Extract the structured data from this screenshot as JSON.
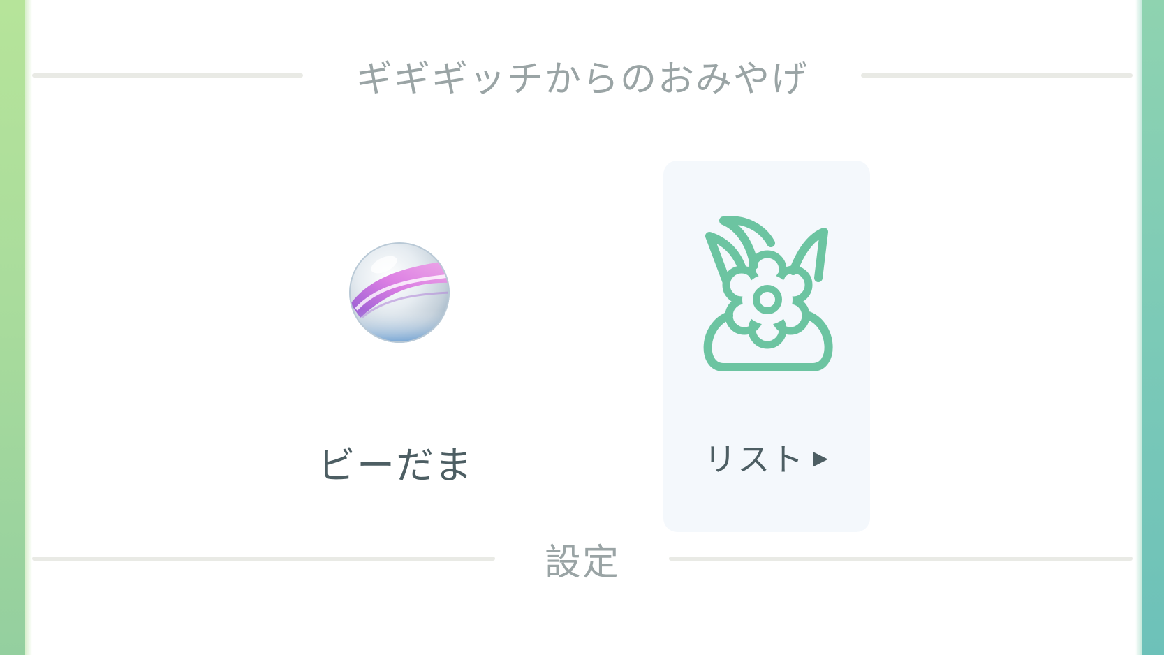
{
  "gift_section": {
    "title": "ギギギッチからのおみやげ"
  },
  "item": {
    "name": "ビーだま",
    "icon": "marble-icon"
  },
  "list_button": {
    "label": "リスト",
    "arrow": "▶",
    "icon": "flower-bag-icon",
    "accent_color": "#6cc4a1"
  },
  "settings_section": {
    "title": "設定"
  },
  "colors": {
    "edge_left": "#a8db9c",
    "edge_right": "#7ccab7",
    "header_text": "#9aa4a5",
    "label_text": "#4d5e63",
    "card_background": "#f4f8fc"
  }
}
